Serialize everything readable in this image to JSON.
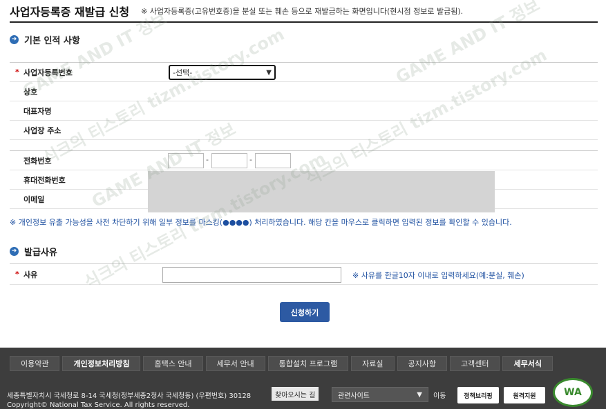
{
  "header": {
    "title": "사업자등록증 재발급 신청",
    "note": "※ 사업자등록증(고유번호증)을 분실 또는 훼손 등으로 재발급하는 화면입니다(현시점 정보로 발급됨)."
  },
  "basic_section": {
    "title": "기본 인적 사항",
    "rows": [
      {
        "label": "사업자등록번호",
        "required": "*",
        "select_value": "-선택-"
      },
      {
        "label": "상호"
      },
      {
        "label": "대표자명"
      },
      {
        "label": "사업장 주소"
      },
      {
        "label": "전화번호"
      },
      {
        "label": "휴대전화번호"
      },
      {
        "label": "이메일"
      }
    ],
    "phone_dash": "-"
  },
  "privacy_note": "※ 개인정보 유출 가능성을 사전 차단하기 위해 일부 정보를 마스킹(●●●●) 처리하였습니다. 해당 칸을 마우스로 클릭하면 입력된 정보를 확인할 수 있습니다.",
  "reason_section": {
    "title": "발급사유",
    "label": "사유",
    "required": "*",
    "hint": "※ 사유를 한글10자 이내로 입력하세요(예:분실, 훼손)"
  },
  "submit_label": "신청하기",
  "footer": {
    "nav": [
      "이용약관",
      "개인정보처리방침",
      "홈택스 안내",
      "세무서 안내",
      "통합설치 프로그램",
      "자료실",
      "공지사항",
      "고객센터",
      "세무서식"
    ],
    "address": "세종특별자치시 국세청로 8-14 국세청(정부세종2청사 국세청동) (우편번호) 30128",
    "directions": "찾아오시는 길",
    "copyright": "Copyright© National Tax Service. All rights reserved.",
    "related_select": "관련사이트",
    "go": "이동",
    "badge_policy": "정책브리핑",
    "badge_remote": "원격지원",
    "wa_mark": "WA"
  },
  "watermark": {
    "text1": "GAME AND IT 정보",
    "text2": "식크의 티스토리 tizm.tistory.com"
  }
}
